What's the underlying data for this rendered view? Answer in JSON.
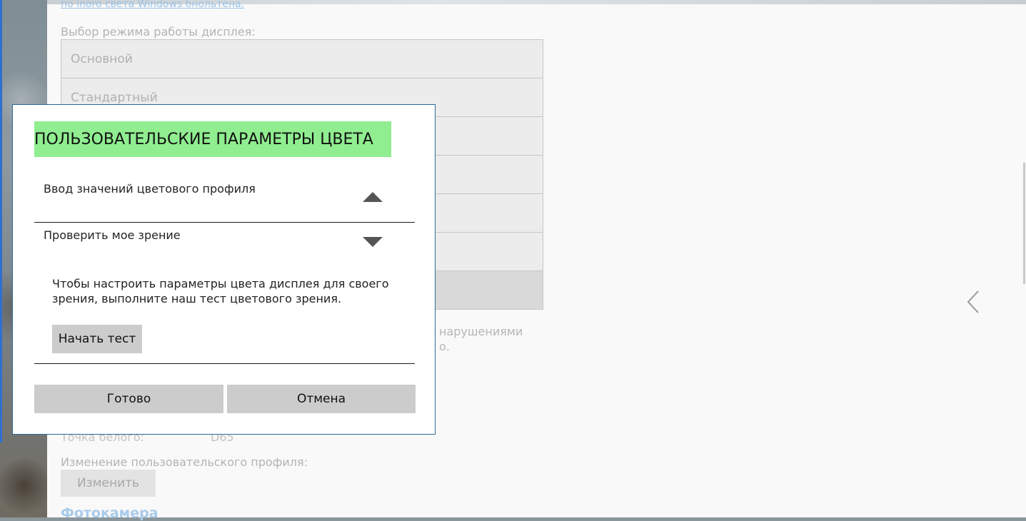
{
  "background": {
    "top_link": "по inoro света Windows бнольтена.",
    "display_mode_label": "Выбор режима работы дисплея:",
    "display_modes": [
      {
        "label": "Основной"
      },
      {
        "label": "Стандартный"
      },
      {
        "label": ""
      },
      {
        "label": ""
      },
      {
        "label": ""
      },
      {
        "label": ""
      },
      {
        "label": ""
      }
    ],
    "partial_text_1": "нарушениями",
    "partial_text_2": "о.",
    "white_point_label": "Точка белого:",
    "white_point_value": "D65",
    "edit_profile_label": "Изменение пользовательского профиля:",
    "edit_button": "Изменить",
    "camera_heading": "Фотокамера"
  },
  "dialog": {
    "title": "ПОЛЬЗОВАТЕЛЬСКИЕ ПАРАМЕТРЫ ЦВЕТА",
    "sections": [
      {
        "label": "Ввод значений цветового профиля",
        "state": "collapsed"
      },
      {
        "label": "Проверить мое зрение",
        "state": "expanded"
      }
    ],
    "description": "Чтобы настроить параметры цвета дисплея для своего зрения, выполните наш тест цветового зрения.",
    "start_test_button": "Начать тест",
    "done_button": "Готово",
    "cancel_button": "Отмена"
  },
  "colors": {
    "title_highlight": "#90ee90",
    "dialog_border": "#2c6a96",
    "button_gray": "#cccccc"
  },
  "icons": {
    "section1_chevron": "chevron-up-icon",
    "section2_chevron": "chevron-down-icon",
    "side_nav": "chevron-left-icon"
  }
}
